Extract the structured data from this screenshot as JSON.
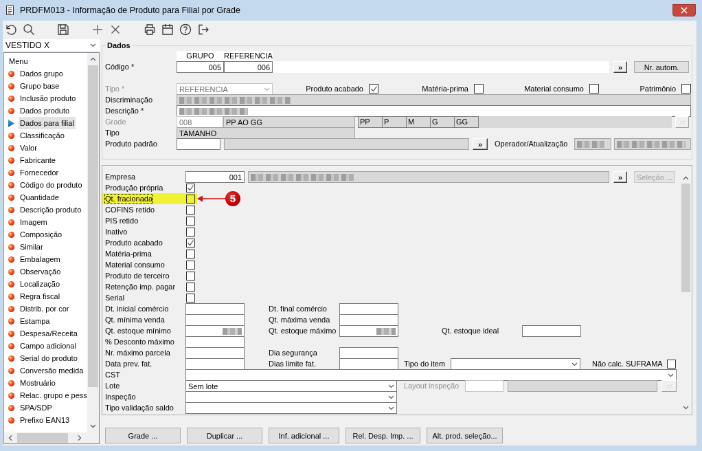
{
  "window": {
    "title": "PRDFM013 - Informação de Produto para Filial por Grade"
  },
  "sidebar": {
    "selector": {
      "value": "VESTIDO X"
    },
    "menu": {
      "title": "Menu",
      "items": [
        {
          "label": "Dados grupo",
          "selected": false
        },
        {
          "label": "Grupo base",
          "selected": false
        },
        {
          "label": "Inclusão produto",
          "selected": false
        },
        {
          "label": "Dados produto",
          "selected": false
        },
        {
          "label": "Dados para filial",
          "selected": true
        },
        {
          "label": "Classificação",
          "selected": false
        },
        {
          "label": "Valor",
          "selected": false
        },
        {
          "label": "Fabricante",
          "selected": false
        },
        {
          "label": "Fornecedor",
          "selected": false
        },
        {
          "label": "Código do produto",
          "selected": false
        },
        {
          "label": "Quantidade",
          "selected": false
        },
        {
          "label": "Descrição produto",
          "selected": false
        },
        {
          "label": "Imagem",
          "selected": false
        },
        {
          "label": "Composição",
          "selected": false
        },
        {
          "label": "Similar",
          "selected": false
        },
        {
          "label": "Embalagem",
          "selected": false
        },
        {
          "label": "Observação",
          "selected": false
        },
        {
          "label": "Localização",
          "selected": false
        },
        {
          "label": "Regra fiscal",
          "selected": false
        },
        {
          "label": "Distrib. por cor",
          "selected": false
        },
        {
          "label": "Estampa",
          "selected": false
        },
        {
          "label": "Despesa/Receita",
          "selected": false
        },
        {
          "label": "Campo adicional",
          "selected": false
        },
        {
          "label": "Serial do produto",
          "selected": false
        },
        {
          "label": "Conversão medida",
          "selected": false
        },
        {
          "label": "Mostruário",
          "selected": false
        },
        {
          "label": "Relac. grupo e pess",
          "selected": false
        },
        {
          "label": "SPA/SDP",
          "selected": false
        },
        {
          "label": "Prefixo EAN13",
          "selected": false
        }
      ]
    }
  },
  "dados": {
    "title": "Dados",
    "codigo": {
      "label": "Código *",
      "columns": [
        "GRUPO",
        "REFERENCIA"
      ],
      "values": [
        "005",
        "006"
      ],
      "lookup_button": "»",
      "auto_button": "Nr. autom."
    },
    "tipo": {
      "label": "Tipo *",
      "value": "REFERENCIA",
      "disabled": true
    },
    "flags": [
      {
        "label": "Produto acabado",
        "checked": true
      },
      {
        "label": "Matéria-prima",
        "checked": false
      },
      {
        "label": "Material consumo",
        "checked": false
      },
      {
        "label": "Patrimônio",
        "checked": false
      }
    ],
    "discriminacao": {
      "label": "Discriminação",
      "readonly": true,
      "redacted": true
    },
    "descricao": {
      "label": "Descrição *",
      "readonly": false,
      "redacted": true
    },
    "grade": {
      "label": "Grade",
      "disabled": true,
      "code": "008",
      "name": {
        "value": "PP AO GG",
        "readonly": true
      },
      "sizes": [
        "PP",
        "P",
        "M",
        "G",
        "GG"
      ]
    },
    "tipo_grade": {
      "label": "Tipo",
      "value": "TAMANHO",
      "readonly": true
    },
    "produto_padrao": {
      "label": "Produto padrão",
      "description": {
        "readonly": true
      },
      "lookup_button": "»"
    },
    "operador": {
      "label": "Operador/Atualização",
      "fields": [
        {
          "readonly": true,
          "redacted": true
        },
        {
          "readonly": true,
          "redacted": true
        }
      ]
    }
  },
  "detail": {
    "empresa": {
      "label": "Empresa",
      "code": "001",
      "name": {
        "readonly": true,
        "redacted": true
      },
      "lookup_button": "»",
      "selection_button": {
        "label": "Seleção ...",
        "disabled": true
      }
    },
    "checks": [
      {
        "label": "Produção própria",
        "checked": true,
        "highlighted": false
      },
      {
        "label": "Qt. fracionada",
        "checked": false,
        "highlighted": true,
        "callout": "5"
      },
      {
        "label": "COFINS retido",
        "checked": false,
        "highlighted": false
      },
      {
        "label": "PIS retido",
        "checked": false,
        "highlighted": false
      },
      {
        "label": "Inativo",
        "checked": false,
        "highlighted": false
      },
      {
        "label": "Produto acabado",
        "checked": true,
        "highlighted": false
      },
      {
        "label": "Matéria-prima",
        "checked": false,
        "highlighted": false
      },
      {
        "label": "Material consumo",
        "checked": false,
        "highlighted": false
      },
      {
        "label": "Produto de terceiro",
        "checked": false,
        "highlighted": false
      },
      {
        "label": "Retenção imp. pagar",
        "checked": false,
        "highlighted": false
      },
      {
        "label": "Serial",
        "checked": false,
        "highlighted": false
      }
    ],
    "fields": [
      [
        {
          "kind": "text",
          "label": "Dt. inicial comércio"
        },
        {
          "kind": "text",
          "label": "Dt. final comércio"
        }
      ],
      [
        {
          "kind": "text",
          "label": "Qt. mínima venda"
        },
        {
          "kind": "text",
          "label": "Qt. máxima venda"
        }
      ],
      [
        {
          "kind": "text",
          "label": "Qt. estoque mínimo",
          "redacted": true
        },
        {
          "kind": "text",
          "label": "Qt. estoque máximo",
          "redacted": true
        },
        {
          "kind": "text",
          "label": "Qt. estoque ideal"
        }
      ],
      [
        {
          "kind": "text",
          "label": "% Desconto máximo"
        }
      ],
      [
        {
          "kind": "text",
          "label": "Nr. máximo parcela"
        },
        {
          "kind": "text",
          "label": "Dia segurança"
        }
      ],
      [
        {
          "kind": "text",
          "label": "Data prev. fat."
        },
        {
          "kind": "text",
          "label": "Dias limite fat."
        },
        {
          "kind": "combo",
          "label": "Tipo do item"
        },
        {
          "kind": "check",
          "label": "Não calc. SUFRAMA",
          "checked": false
        }
      ],
      [
        {
          "kind": "combo",
          "label": "CST"
        }
      ],
      [
        {
          "kind": "combo",
          "label": "Lote",
          "value": "Sem lote"
        },
        {
          "kind": "lookup",
          "label": "Layout inspeção",
          "disabled": true
        }
      ],
      [
        {
          "kind": "combo",
          "label": "Inspeção"
        }
      ],
      [
        {
          "kind": "combo",
          "label": "Tipo validação saldo"
        }
      ]
    ]
  },
  "buttons": [
    "Grade ...",
    "Duplicar ...",
    "Inf. adicional ...",
    "Rel. Desp. Imp. ...",
    "Alt. prod. seleção..."
  ]
}
